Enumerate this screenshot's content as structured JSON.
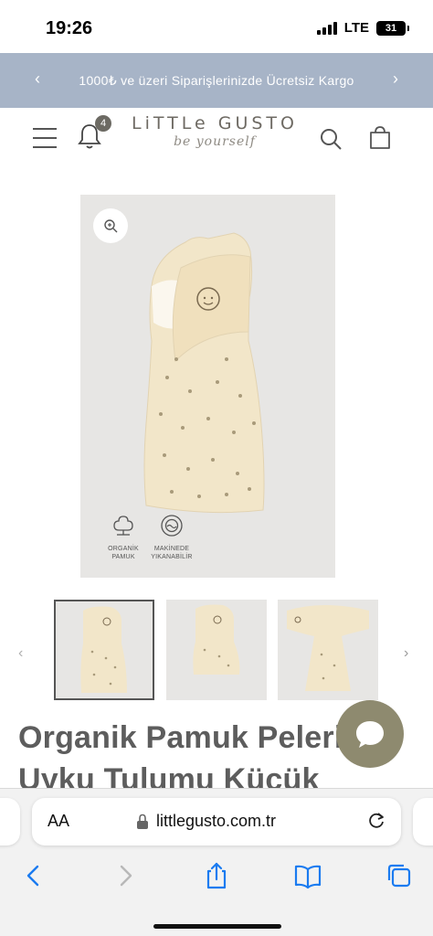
{
  "status_bar": {
    "time": "19:26",
    "network": "LTE",
    "battery": "31"
  },
  "announcement": {
    "text": "1000₺ ve üzeri Siparişlerinizde Ücretsiz Kargo",
    "prev_icon": "chevron-left-icon",
    "next_icon": "chevron-right-icon"
  },
  "header": {
    "menu_icon": "hamburger-menu-icon",
    "notification_count": "4",
    "logo_main": "LiTTLe GUSTO",
    "logo_sub": "be yourself",
    "search_icon": "search-icon",
    "cart_icon": "cart-bag-icon"
  },
  "product": {
    "badges": [
      {
        "label": "ORGANİK PAMUK",
        "icon": "cotton-flower-icon"
      },
      {
        "label": "MAKİNEDE YIKANABİLİR",
        "icon": "washing-machine-icon"
      }
    ],
    "title": "Organik Pamuk Pelerin Uyku Tulumu Küçük",
    "zoom_icon": "zoom-in-icon",
    "colors": {
      "image_bg": "#e7e6e4",
      "fabric": "#f2e5c8",
      "accent": "#8e8a6f"
    }
  },
  "thumbnails": {
    "count": 3,
    "selected": 1
  },
  "browser": {
    "url": "littlegusto.com.tr",
    "aa_label": "AA",
    "nav_icons": [
      "back-icon",
      "forward-icon",
      "share-icon",
      "bookmarks-icon",
      "tabs-icon"
    ]
  }
}
